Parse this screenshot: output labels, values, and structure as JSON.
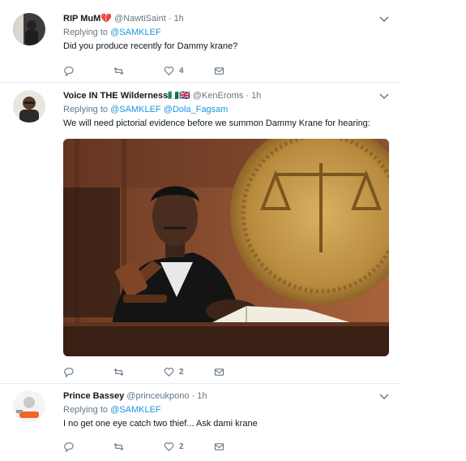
{
  "tweets": [
    {
      "name": "RIP MuM💔",
      "handle": "@NawtiSaint",
      "time": "· 1h",
      "replying_prefix": "Replying to",
      "replying_to": [
        "@SAMKLEF"
      ],
      "text": "Did you produce recently for Dammy krane?",
      "counts": {
        "reply": "",
        "retweet": "",
        "like": "4"
      }
    },
    {
      "name": "Voice IN THE Wilderness🇳🇬🇬🇧",
      "handle": "@KenEroms",
      "time": "· 1h",
      "replying_prefix": "Replying to",
      "replying_to": [
        "@SAMKLEF",
        "@Dola_Fagsam"
      ],
      "text": "We will need pictorial evidence before we summon Dammy Krane for hearing:",
      "counts": {
        "reply": "",
        "retweet": "",
        "like": "2"
      }
    },
    {
      "name": "Prince Bassey",
      "handle": "@princeukpono",
      "time": "· 1h",
      "replying_prefix": "Replying to",
      "replying_to": [
        "@SAMKLEF"
      ],
      "text": "I no get one eye catch two thief... Ask dami krane",
      "counts": {
        "reply": "",
        "retweet": "",
        "like": "2"
      }
    }
  ],
  "colors": {
    "link": "#1b95e0",
    "muted": "#657786",
    "divider": "#e6ecf0"
  }
}
